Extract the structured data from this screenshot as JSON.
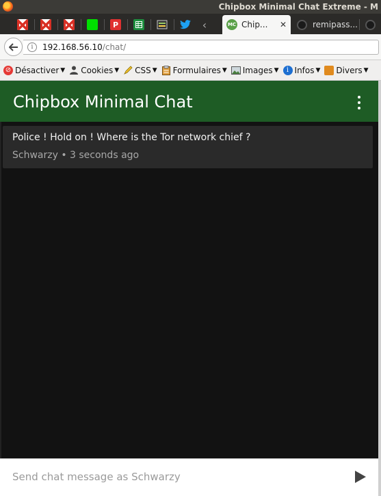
{
  "window": {
    "title": "Chipbox Minimal Chat Extreme - M"
  },
  "tabs": {
    "pinned": [
      {
        "icon": "gmail-icon"
      },
      {
        "icon": "gmail-icon"
      },
      {
        "icon": "gmail-icon"
      },
      {
        "icon": "green-square-icon",
        "color": "#00e000"
      },
      {
        "icon": "pocket-icon",
        "letter": "P",
        "color": "#e03131"
      },
      {
        "icon": "sheets-icon",
        "color": "#1e8e3e"
      },
      {
        "icon": "monitor-icon"
      },
      {
        "icon": "twitter-icon",
        "color": "#1da1f2"
      }
    ],
    "active": {
      "badge": "MC",
      "label": "Chip...",
      "close": "✕"
    },
    "others": [
      {
        "label": "remipass..."
      },
      {
        "label": ""
      }
    ]
  },
  "nav": {
    "url_host": "192.168.56.10",
    "url_path": "/chat/"
  },
  "bookmarks": [
    {
      "label": "Désactiver",
      "icon": "block-icon"
    },
    {
      "label": "Cookies",
      "icon": "person-icon"
    },
    {
      "label": "CSS",
      "icon": "pencil-icon"
    },
    {
      "label": "Formulaires",
      "icon": "clipboard-icon"
    },
    {
      "label": "Images",
      "icon": "image-icon"
    },
    {
      "label": "Infos",
      "icon": "info-icon"
    },
    {
      "label": "Divers",
      "icon": "misc-icon"
    }
  ],
  "app": {
    "title": "Chipbox Minimal Chat",
    "header_color": "#1e5c25"
  },
  "messages": [
    {
      "text": "Police ! Hold on ! Where is the Tor network chief ?",
      "author": "Schwarzy",
      "time": "3 seconds ago",
      "meta": "Schwarzy • 3 seconds ago"
    }
  ],
  "composer": {
    "placeholder": "Send chat message as Schwarzy"
  }
}
